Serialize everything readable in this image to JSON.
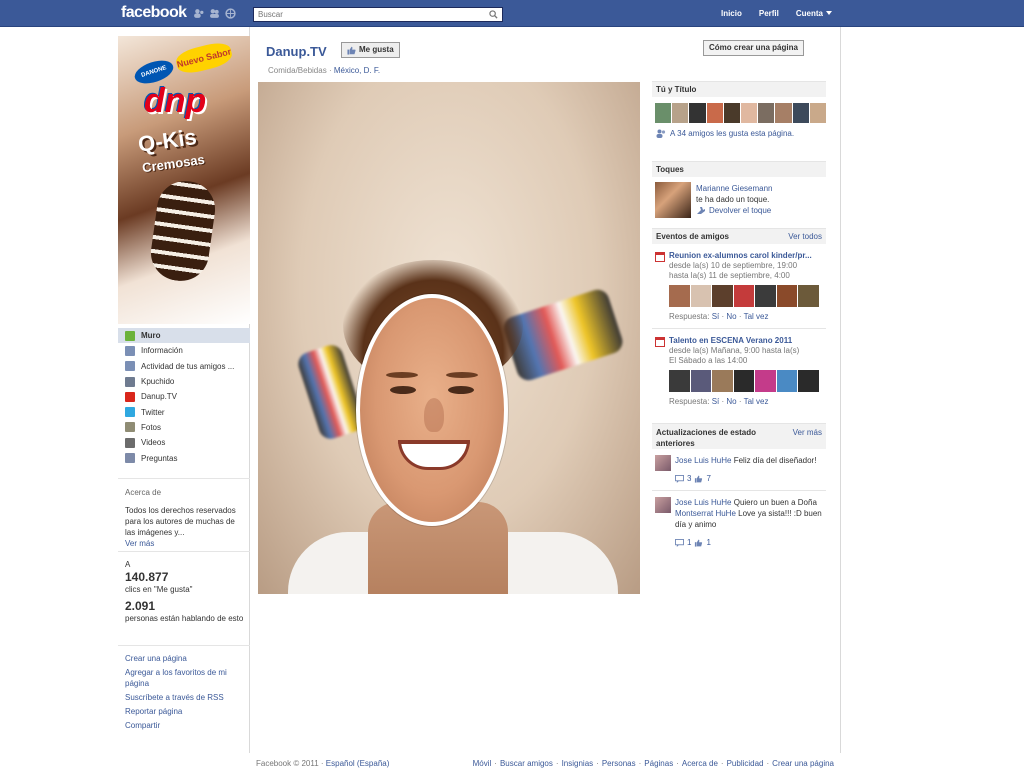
{
  "topbar": {
    "logo": "facebook",
    "search_placeholder": "Buscar",
    "nav": {
      "home": "Inicio",
      "profile": "Perfil",
      "account": "Cuenta"
    }
  },
  "page": {
    "name": "Danup.TV",
    "like_button": "Me gusta",
    "category": "Comida/Bebidas",
    "location": "México, D. F.",
    "create_page_button": "Cómo crear una página"
  },
  "profile_pic": {
    "brand": "DANONE",
    "badge": "Nuevo Sabor",
    "logo": "dnp",
    "product": "Q-Kis",
    "product_sub": "Cremosas"
  },
  "leftnav": [
    {
      "label": "Muro",
      "icon": "wall-icon",
      "color": "#6bb23a",
      "active": true
    },
    {
      "label": "Información",
      "icon": "info-icon",
      "color": "#7b8fb5",
      "active": false
    },
    {
      "label": "Actividad de tus amigos ...",
      "icon": "friends-activity-icon",
      "color": "#7b8fb5",
      "active": false
    },
    {
      "label": "Kpuchido",
      "icon": "app-star-icon",
      "color": "#6f7b90",
      "active": false
    },
    {
      "label": "Danup.TV",
      "icon": "youtube-icon",
      "color": "#d9261c",
      "active": false
    },
    {
      "label": "Twitter",
      "icon": "twitter-icon",
      "color": "#2fa8e0",
      "active": false
    },
    {
      "label": "Fotos",
      "icon": "photos-icon",
      "color": "#8f8c74",
      "active": false
    },
    {
      "label": "Videos",
      "icon": "videos-icon",
      "color": "#6c6c6c",
      "active": false
    },
    {
      "label": "Preguntas",
      "icon": "questions-icon",
      "color": "#7d8aa8",
      "active": false
    }
  ],
  "about": {
    "heading": "Acerca de",
    "text": "Todos los derechos reservados para los autores de muchas de las imágenes y...",
    "more": "Ver más"
  },
  "stats": {
    "prefix": "A",
    "likes": "140.877",
    "likes_label": "clics en \"Me gusta\"",
    "talking": "2.091",
    "talking_label": "personas están hablando de esto"
  },
  "left_links": [
    "Crear una página",
    "Agregar a los favoritos de mi página",
    "Suscríbete a través de RSS",
    "Reportar página",
    "Compartir"
  ],
  "right": {
    "you_and": {
      "title": "Tú y Título",
      "friends_count": "A 34 amigos les gusta esta página.",
      "thumb_colors": [
        "#6a8f6a",
        "#b7a28a",
        "#333",
        "#c96a4a",
        "#4a3a2a",
        "#e0b8a0",
        "#7b6d61",
        "#a67f66",
        "#3d4a5b",
        "#c9a98a"
      ]
    },
    "pokes": {
      "title": "Toques",
      "name": "Marianne Giesemann",
      "text": "te ha dado un toque.",
      "action": "Devolver el toque"
    },
    "events": {
      "title": "Eventos de amigos",
      "see_all": "Ver todos",
      "items": [
        {
          "title": "Reunion ex-alumnos carol kinder/pr...",
          "from": "desde la(s) 10 de septiembre, 19:00",
          "to": "hasta la(s) 11 de septiembre, 4:00",
          "thumb_colors": [
            "#a56b4e",
            "#d8c2b0",
            "#5c3f2c",
            "#c43b3b",
            "#3b3b3b",
            "#8a4a2a",
            "#6c5a3a"
          ],
          "response_label": "Respuesta:",
          "yes": "Sí",
          "no": "No",
          "maybe": "Tal vez"
        },
        {
          "title": "Talento en ESCENA Verano 2011",
          "from": "desde la(s) Mañana, 9:00 hasta la(s)",
          "to": "El Sábado a las 14:00",
          "thumb_colors": [
            "#3a3a3a",
            "#5a5a7a",
            "#9a7a5a",
            "#2a2a2a",
            "#c43b8a",
            "#4a8ac4",
            "#2a2a2a"
          ],
          "response_label": "Respuesta:",
          "yes": "Sí",
          "no": "No",
          "maybe": "Tal vez"
        }
      ]
    },
    "updates": {
      "title": "Actualizaciones de estado anteriores",
      "see_more": "Ver más",
      "items": [
        {
          "author": "Jose Luis HuHe",
          "text": "Feliz día del diseñador!",
          "comments": "3",
          "likes": "7"
        },
        {
          "author": "Jose Luis HuHe",
          "text_before": "Quiero un buen a Doña",
          "mention": "Montserrat HuHe",
          "text_after": "Love ya sista!!! :D buen día y animo",
          "comments": "1",
          "likes": "1"
        }
      ]
    }
  },
  "footer": {
    "copyright": "Facebook © 2011 ·",
    "language": "Español (España)",
    "links": [
      "Móvil",
      "Buscar amigos",
      "Insignias",
      "Personas",
      "Páginas",
      "Acerca de",
      "Publicidad",
      "Crear una página"
    ]
  },
  "colors": {
    "brand_blue": "#3b5998",
    "header_bar": "#3b5998",
    "link": "#3b5998"
  }
}
